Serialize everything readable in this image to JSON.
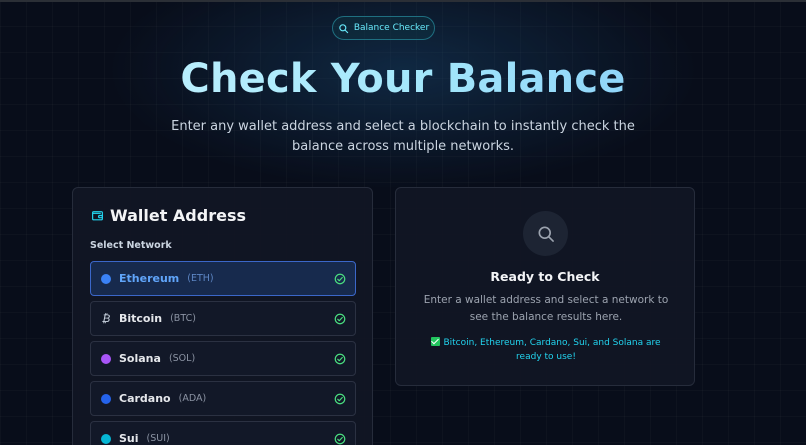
{
  "badge": {
    "label": "Balance Checker",
    "icon": "search-icon"
  },
  "hero": {
    "title": "Check Your Balance",
    "subtitle": "Enter any wallet address and select a blockchain to instantly check the balance across multiple networks."
  },
  "wallet_panel": {
    "title": "Wallet Address",
    "icon": "wallet-icon",
    "section_label": "Select Network",
    "networks": [
      {
        "name": "Ethereum",
        "symbol": "(ETH)",
        "color": "#3b82f6",
        "selected": true
      },
      {
        "name": "Bitcoin",
        "symbol": "(BTC)",
        "icon": "bitcoin-icon",
        "selected": false
      },
      {
        "name": "Solana",
        "symbol": "(SOL)",
        "color": "#a855f7",
        "selected": false
      },
      {
        "name": "Cardano",
        "symbol": "(ADA)",
        "color": "#2563eb",
        "selected": false
      },
      {
        "name": "Sui",
        "symbol": "(SUI)",
        "color": "#06b6d4",
        "selected": false
      }
    ]
  },
  "result_panel": {
    "icon": "search-icon",
    "title": "Ready to Check",
    "description": "Enter a wallet address and select a network to see the balance results here.",
    "note": "Bitcoin, Ethereum, Cardano, Sui, and Solana are ready to use!"
  },
  "colors": {
    "accent": "#22d3ee",
    "selected_border": "#3b67c9",
    "check": "#4ade80"
  }
}
